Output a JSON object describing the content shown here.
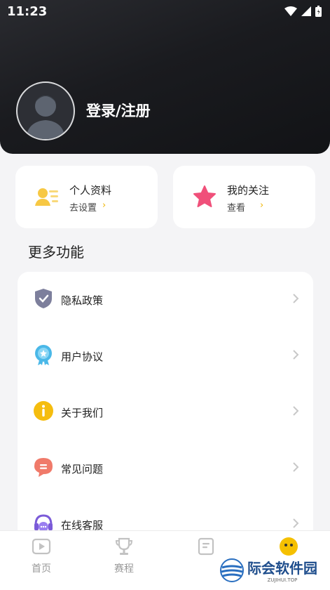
{
  "status_bar": {
    "time": "11:23"
  },
  "header": {
    "login_label": "登录/注册"
  },
  "cards": [
    {
      "title": "个人资料",
      "subtitle": "去设置",
      "arrow": "›"
    },
    {
      "title": "我的关注",
      "subtitle": "查看",
      "arrow": "›"
    }
  ],
  "section": {
    "title": "更多功能"
  },
  "menu": [
    {
      "label": "隐私政策",
      "icon": "shield-icon"
    },
    {
      "label": "用户协议",
      "icon": "badge-icon"
    },
    {
      "label": "关于我们",
      "icon": "info-icon"
    },
    {
      "label": "常见问题",
      "icon": "chat-icon"
    },
    {
      "label": "在线客服",
      "icon": "headset-icon"
    }
  ],
  "tabbar": [
    {
      "label": "首页",
      "icon": "play-icon"
    },
    {
      "label": "赛程",
      "icon": "trophy-icon"
    },
    {
      "label": "",
      "icon": "document-icon"
    },
    {
      "label": "",
      "icon": "smiley-icon"
    }
  ],
  "watermark": {
    "text": "际会软件园",
    "sub": "ZUJIHUI.TOP"
  },
  "colors": {
    "accent": "#f0b400",
    "header_dark": "#1a1b1f",
    "star": "#f0507a"
  }
}
